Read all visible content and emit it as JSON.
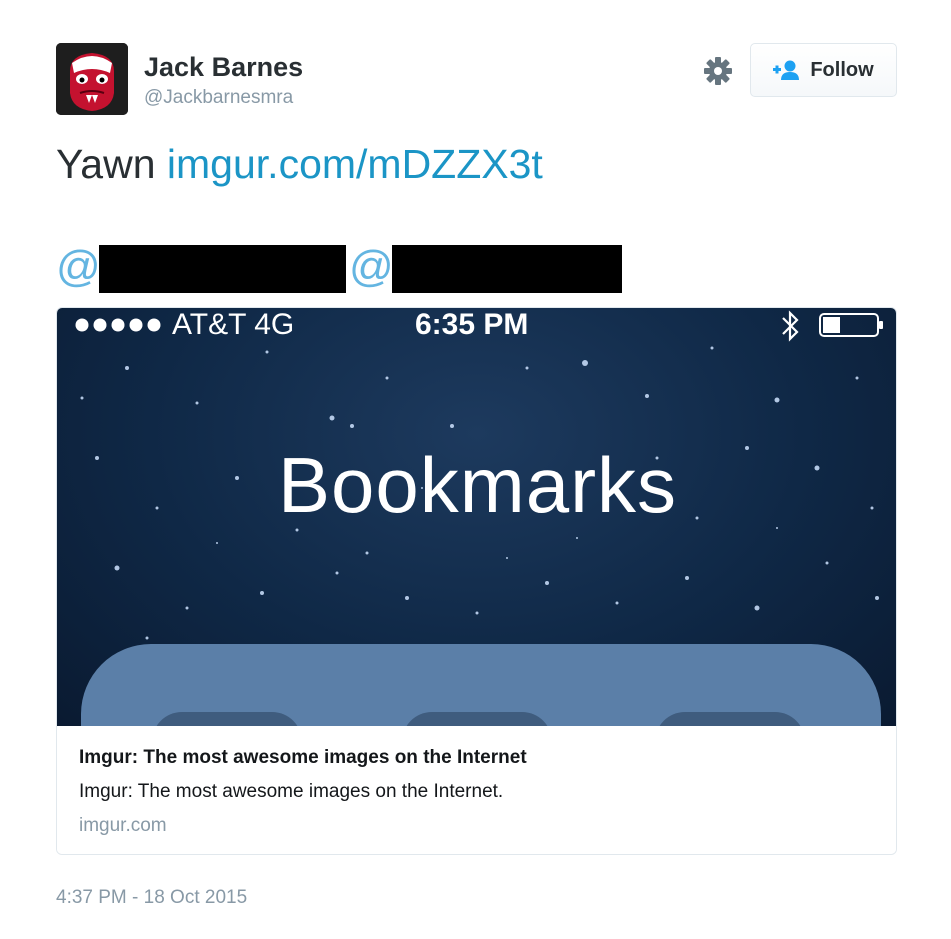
{
  "author": {
    "name": "Jack Barnes",
    "handle": "@Jackbarnesmra",
    "avatar_icon": "masked-face-avatar"
  },
  "actions": {
    "settings_icon": "gear-icon",
    "follow_label": "Follow",
    "follow_icon": "add-user-icon"
  },
  "tweet": {
    "text_prefix": "Yawn ",
    "link_text": "imgur.com/mDZZX3t",
    "mentions": [
      "@",
      "@"
    ]
  },
  "card": {
    "image": {
      "status_carrier": "AT&T   4G",
      "status_time": "6:35 PM",
      "title": "Bookmarks"
    },
    "title": "Imgur: The most awesome images on the Internet",
    "description": "Imgur: The most awesome images on the Internet.",
    "domain": "imgur.com"
  },
  "timestamp": "4:37 PM - 18 Oct 2015",
  "colors": {
    "link": "#1b95c6",
    "mention": "#64b5e1",
    "muted": "#8899a6",
    "text": "#292f33",
    "follow_icon": "#1da1f2"
  }
}
